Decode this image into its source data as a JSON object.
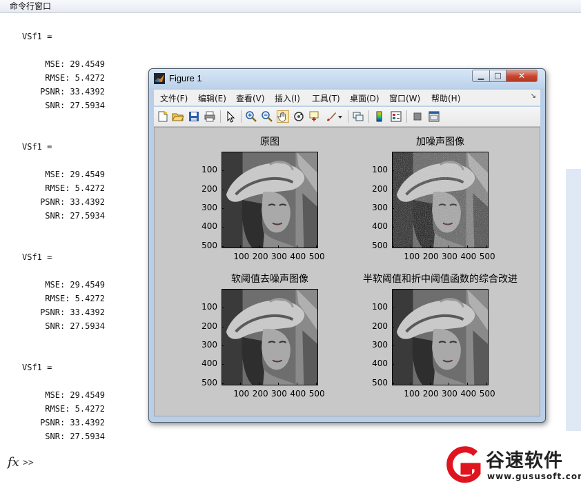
{
  "command_window": {
    "title": "命令行窗口",
    "blocks": [
      {
        "var": "VSf1 =",
        "mse": "MSE: 29.4549",
        "rmse": "RMSE: 5.4272",
        "psnr": "PSNR: 33.4392",
        "snr": "SNR: 27.5934"
      },
      {
        "var": "VSf1 =",
        "mse": "MSE: 29.4549",
        "rmse": "RMSE: 5.4272",
        "psnr": "PSNR: 33.4392",
        "snr": "SNR: 27.5934"
      },
      {
        "var": "VSf1 =",
        "mse": "MSE: 29.4549",
        "rmse": "RMSE: 5.4272",
        "psnr": "PSNR: 33.4392",
        "snr": "SNR: 27.5934"
      },
      {
        "var": "VSf1 =",
        "mse": "MSE: 29.4549",
        "rmse": "RMSE: 5.4272",
        "psnr": "PSNR: 33.4392",
        "snr": "SNR: 27.5934"
      }
    ],
    "fx_label": "fx",
    "prompt": ">>"
  },
  "figure": {
    "title": "Figure 1",
    "caption_buttons": {
      "min": "▁",
      "max": "□",
      "close": "✕"
    },
    "menu": [
      "文件(F)",
      "编辑(E)",
      "查看(V)",
      "插入(I)",
      "工具(T)",
      "桌面(D)",
      "窗口(W)",
      "帮助(H)"
    ],
    "menu_overflow": "↘",
    "toolbar_icons": [
      "new-figure-icon",
      "open-file-icon",
      "save-icon",
      "print-icon",
      "pointer-icon",
      "zoom-in-icon",
      "zoom-out-icon",
      "pan-hand-icon",
      "rotate-3d-icon",
      "data-cursor-icon",
      "brush-icon",
      "link-plot-icon",
      "colorbar-icon",
      "legend-icon",
      "hide-plot-tools-icon",
      "show-plot-tools-icon"
    ],
    "subplots": [
      {
        "title": "原图",
        "kind": "original"
      },
      {
        "title": "加噪声图像",
        "kind": "noisy"
      },
      {
        "title": "软阈值去噪声图像",
        "kind": "denoised"
      },
      {
        "title": "半软阈值和折中阈值函数的综合改进",
        "kind": "denoised"
      }
    ],
    "y_ticks": [
      "100",
      "200",
      "300",
      "400",
      "500"
    ],
    "x_ticks": [
      "100",
      "200",
      "300",
      "400",
      "500"
    ],
    "axis_range": [
      0,
      512
    ]
  },
  "watermark": {
    "name": "谷速软件",
    "url": "www.gususoft.com",
    "accent": "#e0141e"
  }
}
